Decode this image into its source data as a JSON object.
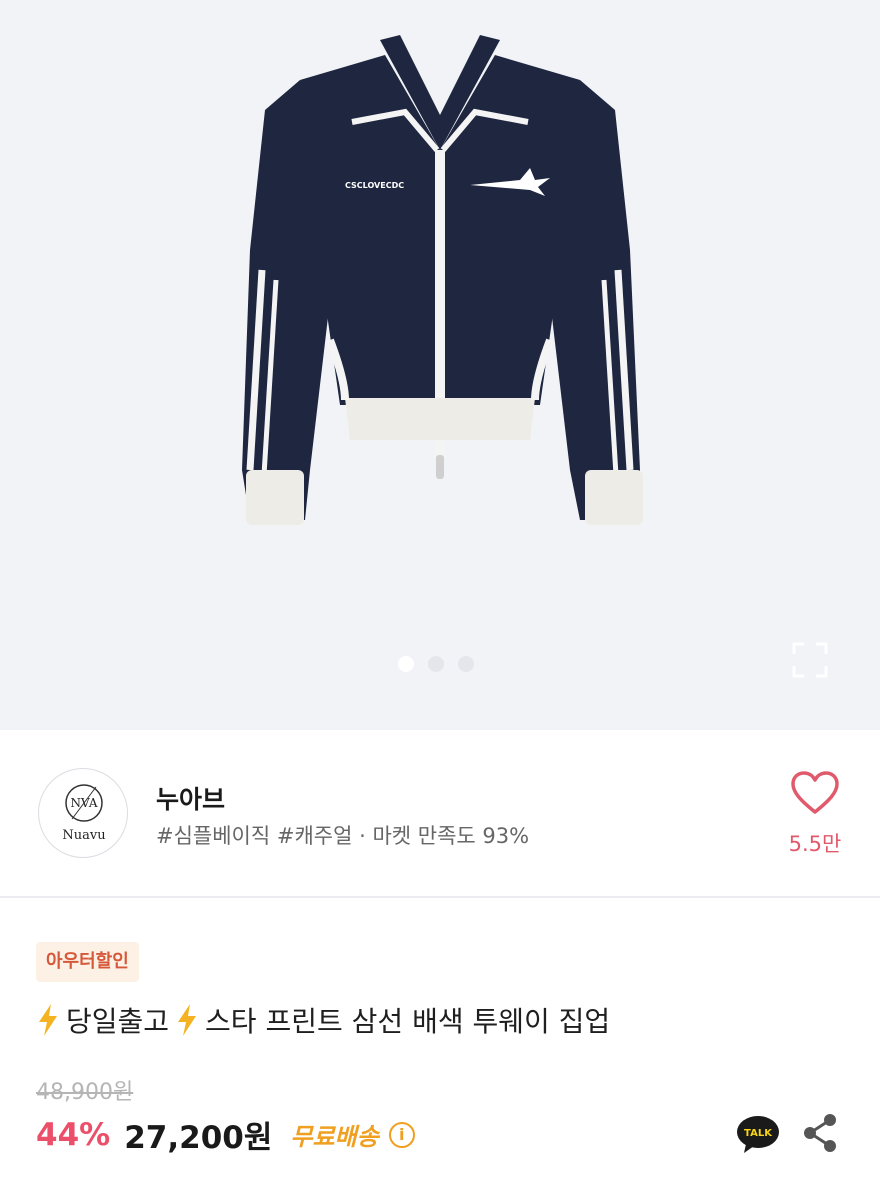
{
  "gallery": {
    "chest_logo_text": "CSCLOVECDC",
    "slide_count": 3,
    "active_slide": 1
  },
  "seller": {
    "logo_text": "Nuavu",
    "logo_monogram": "NVA",
    "name": "누아브",
    "meta": "#심플베이직 #캐주얼 · 마켓 만족도 93%",
    "like_count": "5.5만"
  },
  "product": {
    "badge": "아우터할인",
    "title_part1": "당일출고",
    "title_part2": "스타 프린트 삼선 배색 투웨이 집업",
    "original_price": "48,900원",
    "discount": "44%",
    "price": "27,200원",
    "shipping": "무료배송",
    "info_symbol": "i"
  },
  "actions": {
    "talk_label": "TALK"
  },
  "icons": {
    "heart": "heart-icon",
    "bolt": "lightning-icon",
    "expand": "expand-icon",
    "share": "share-icon",
    "talk": "kakaotalk-icon",
    "info": "info-icon"
  },
  "colors": {
    "discount": "#ec4f6a",
    "shipping": "#f0a021",
    "heart": "#e05a6c",
    "badge_bg": "#fdf1e6",
    "badge_text": "#d6583a",
    "jacket": "#1e2640",
    "hero_bg": "#f2f3f7"
  }
}
